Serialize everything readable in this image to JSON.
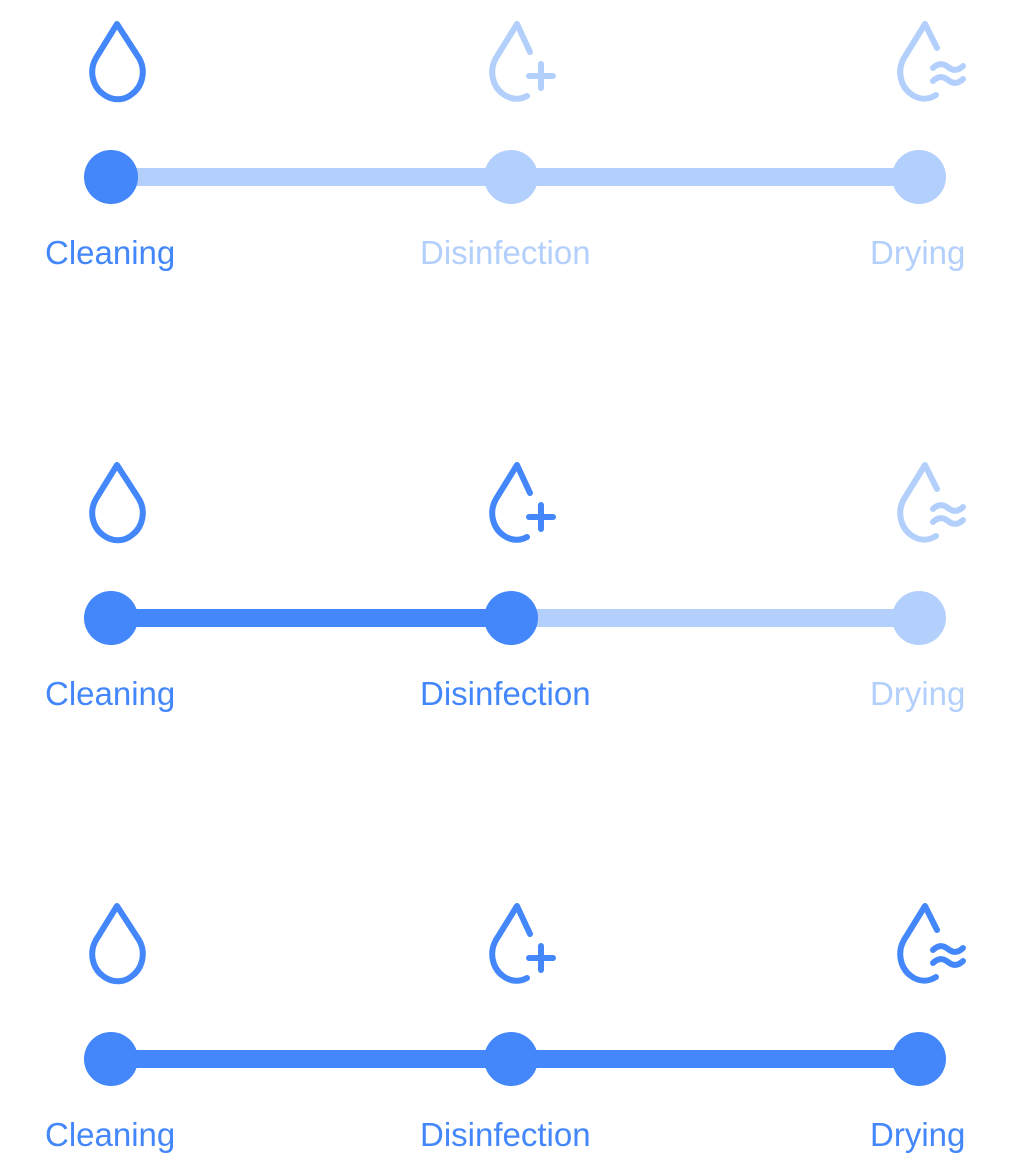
{
  "colors": {
    "active": "#4387fb",
    "inactive": "#b3cffc"
  },
  "steppers": [
    {
      "current_step": 1,
      "steps": [
        {
          "label": "Cleaning",
          "icon": "water-drop-icon",
          "state": "active"
        },
        {
          "label": "Disinfection",
          "icon": "drop-plus-icon",
          "state": "inactive"
        },
        {
          "label": "Drying",
          "icon": "drop-waves-icon",
          "state": "inactive"
        }
      ]
    },
    {
      "current_step": 2,
      "steps": [
        {
          "label": "Cleaning",
          "icon": "water-drop-icon",
          "state": "active"
        },
        {
          "label": "Disinfection",
          "icon": "drop-plus-icon",
          "state": "active"
        },
        {
          "label": "Drying",
          "icon": "drop-waves-icon",
          "state": "inactive"
        }
      ]
    },
    {
      "current_step": 3,
      "steps": [
        {
          "label": "Cleaning",
          "icon": "water-drop-icon",
          "state": "active"
        },
        {
          "label": "Disinfection",
          "icon": "drop-plus-icon",
          "state": "active"
        },
        {
          "label": "Drying",
          "icon": "drop-waves-icon",
          "state": "active"
        }
      ]
    }
  ]
}
